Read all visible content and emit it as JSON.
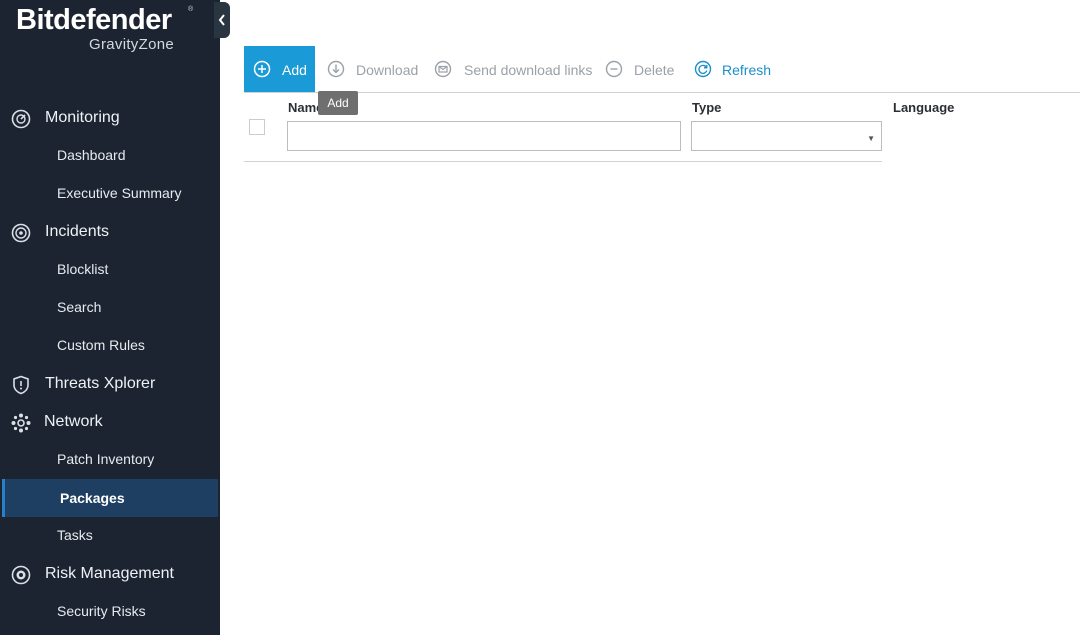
{
  "brand": {
    "name": "Bitdefender",
    "product": "GravityZone",
    "trademark": "®"
  },
  "sidebar": {
    "sections": [
      {
        "label": "Monitoring",
        "icon": "gauge-icon",
        "items": [
          {
            "label": "Dashboard"
          },
          {
            "label": "Executive Summary"
          }
        ]
      },
      {
        "label": "Incidents",
        "icon": "radar-icon",
        "items": [
          {
            "label": "Blocklist"
          },
          {
            "label": "Search"
          },
          {
            "label": "Custom Rules"
          }
        ]
      },
      {
        "label": "Threats Xplorer",
        "icon": "shield-icon",
        "items": []
      },
      {
        "label": "Network",
        "icon": "network-icon",
        "items": [
          {
            "label": "Patch Inventory"
          },
          {
            "label": "Packages",
            "active": true
          },
          {
            "label": "Tasks"
          }
        ]
      },
      {
        "label": "Risk Management",
        "icon": "risk-icon",
        "items": [
          {
            "label": "Security Risks"
          }
        ]
      }
    ]
  },
  "toolbar": {
    "add": "Add",
    "download": "Download",
    "send_links": "Send download links",
    "delete": "Delete",
    "refresh": "Refresh"
  },
  "tooltip": "Add",
  "grid": {
    "columns": {
      "name": "Name",
      "type": "Type",
      "language": "Language"
    },
    "filters": {
      "name": "",
      "type": ""
    }
  },
  "colors": {
    "sidebar_bg": "#1b2430",
    "active_item": "#1e3f61",
    "accent": "#1a9ad6"
  }
}
